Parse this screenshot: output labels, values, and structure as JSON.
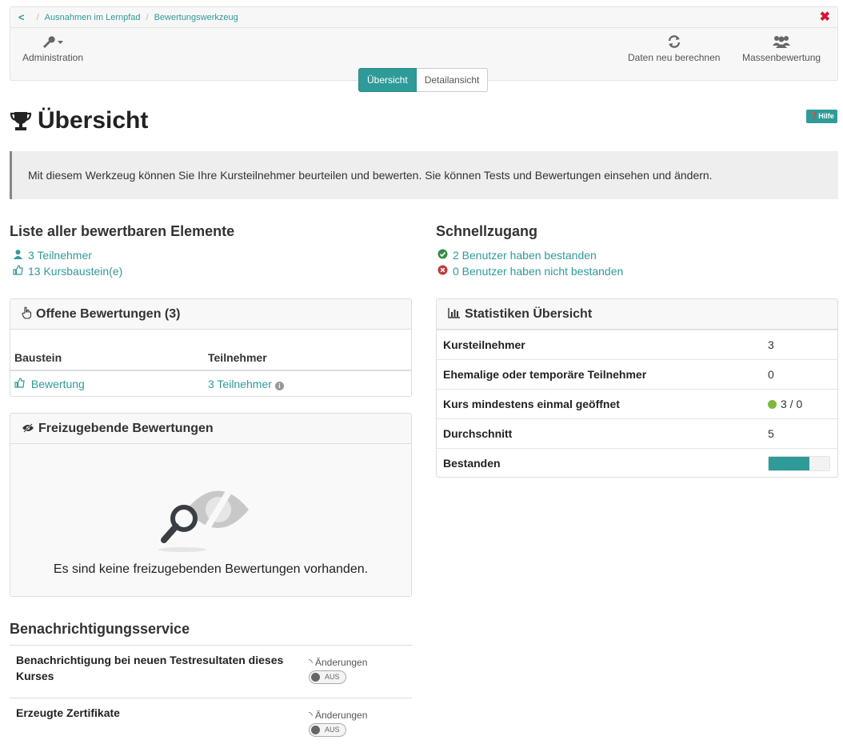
{
  "breadcrumb": {
    "back_label": "<",
    "items": [
      "Ausnahmen im Lernpfad",
      "Bewertungswerkzeug"
    ]
  },
  "toolbar": {
    "close_label": "✖",
    "admin_label": "Administration",
    "recalc_label": "Daten neu berechnen",
    "mass_label": "Massenbewertung"
  },
  "views": {
    "overview_label": "Übersicht",
    "detail_label": "Detailansicht"
  },
  "page": {
    "title": "Übersicht",
    "help_label": "Hilfe",
    "info_text": "Mit diesem Werkzeug können Sie Ihre Kursteilnehmer beurteilen und bewerten. Sie können Tests und Bewertungen einsehen und ändern."
  },
  "list": {
    "heading": "Liste aller bewertbaren Elemente",
    "participants_link": "3 Teilnehmer",
    "nodes_link": "13 Kursbaustein(e)"
  },
  "quick": {
    "heading": "Schnellzugang",
    "passed_link": "2 Benutzer haben bestanden",
    "failed_link": "0 Benutzer haben nicht bestanden"
  },
  "open_reviews": {
    "title": "Offene Bewertungen (3)",
    "col_node": "Baustein",
    "col_participants": "Teilnehmer",
    "rows": [
      {
        "node": "Bewertung",
        "participants": "3 Teilnehmer"
      }
    ]
  },
  "release": {
    "title": "Freizugebende Bewertungen",
    "empty_message": "Es sind keine freizugebenden Bewertungen vorhanden."
  },
  "stats": {
    "title": "Statistiken Übersicht",
    "rows": [
      {
        "label": "Kursteilnehmer",
        "value": "3"
      },
      {
        "label": "Ehemalige oder temporäre Teilnehmer",
        "value": "0"
      },
      {
        "label": "Kurs mindestens einmal geöffnet",
        "value": "3 / 0"
      },
      {
        "label": "Durchschnitt",
        "value": "5"
      },
      {
        "label": "Bestanden",
        "value": ""
      }
    ],
    "passed_fraction": 0.67,
    "accent_color": "#2f9b98",
    "online_color": "#7cb93e"
  },
  "notifications": {
    "heading": "Benachrichtigungsservice",
    "items": [
      {
        "label": "Benachrichtigung bei neuen Testresultaten dieses Kurses",
        "changes": "Änderungen",
        "toggle": "AUS"
      },
      {
        "label": "Erzeugte Zertifikate",
        "changes": "Änderungen",
        "toggle": "AUS"
      }
    ]
  }
}
